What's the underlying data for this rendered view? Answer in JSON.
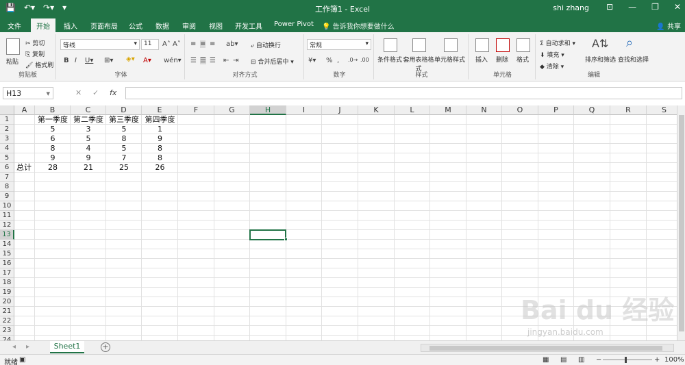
{
  "titlebar": {
    "doc_title": "工作簿1  -  Excel",
    "user": "shi zhang"
  },
  "ribbon_tabs": [
    "文件",
    "开始",
    "插入",
    "页面布局",
    "公式",
    "数据",
    "审阅",
    "视图",
    "开发工具",
    "Power Pivot"
  ],
  "tell_me": "告诉我你想要做什么",
  "share": "共享",
  "clipboard": {
    "paste": "粘贴",
    "cut": "剪切",
    "copy": "复制",
    "format_painter": "格式刷",
    "label": "剪贴板"
  },
  "font": {
    "name": "等线",
    "size": "11",
    "label": "字体"
  },
  "alignment": {
    "wrap": "自动换行",
    "merge": "合并后居中",
    "label": "对齐方式"
  },
  "number": {
    "format": "常规",
    "label": "数字"
  },
  "styles": {
    "conditional": "条件格式",
    "table": "套用表格格式",
    "cell_styles": "单元格样式",
    "label": "样式"
  },
  "cells": {
    "insert": "插入",
    "delete": "删除",
    "format": "格式",
    "label": "单元格"
  },
  "editing": {
    "autosum": "自动求和",
    "fill": "填充",
    "clear": "清除",
    "sort": "排序和筛选",
    "find": "查找和选择",
    "label": "编辑"
  },
  "formula_bar": {
    "name_box": "H13",
    "fx": "fx"
  },
  "columns": [
    "A",
    "B",
    "C",
    "D",
    "E",
    "F",
    "G",
    "H",
    "I",
    "J",
    "K",
    "L",
    "M",
    "N",
    "O",
    "P",
    "Q",
    "R",
    "S"
  ],
  "rows": [
    "1",
    "2",
    "3",
    "4",
    "5",
    "6",
    "7",
    "8",
    "9",
    "10",
    "11",
    "12",
    "13",
    "14",
    "15",
    "16",
    "17",
    "18",
    "19",
    "20",
    "21",
    "22",
    "23",
    "24"
  ],
  "sheet": {
    "headers": [
      "第一季度",
      "第二季度",
      "第三季度",
      "第四季度"
    ],
    "data": [
      [
        "5",
        "3",
        "5",
        "1"
      ],
      [
        "6",
        "5",
        "8",
        "9"
      ],
      [
        "8",
        "4",
        "5",
        "8"
      ],
      [
        "9",
        "9",
        "7",
        "8"
      ]
    ],
    "total_label": "总计",
    "totals": [
      "28",
      "21",
      "25",
      "26"
    ]
  },
  "selected_cell": "H13",
  "sheet_tab": "Sheet1",
  "status": {
    "ready": "就绪",
    "zoom": "100%"
  },
  "watermark": {
    "brand": "Bai du 经验",
    "url": "jingyan.baidu.com"
  }
}
